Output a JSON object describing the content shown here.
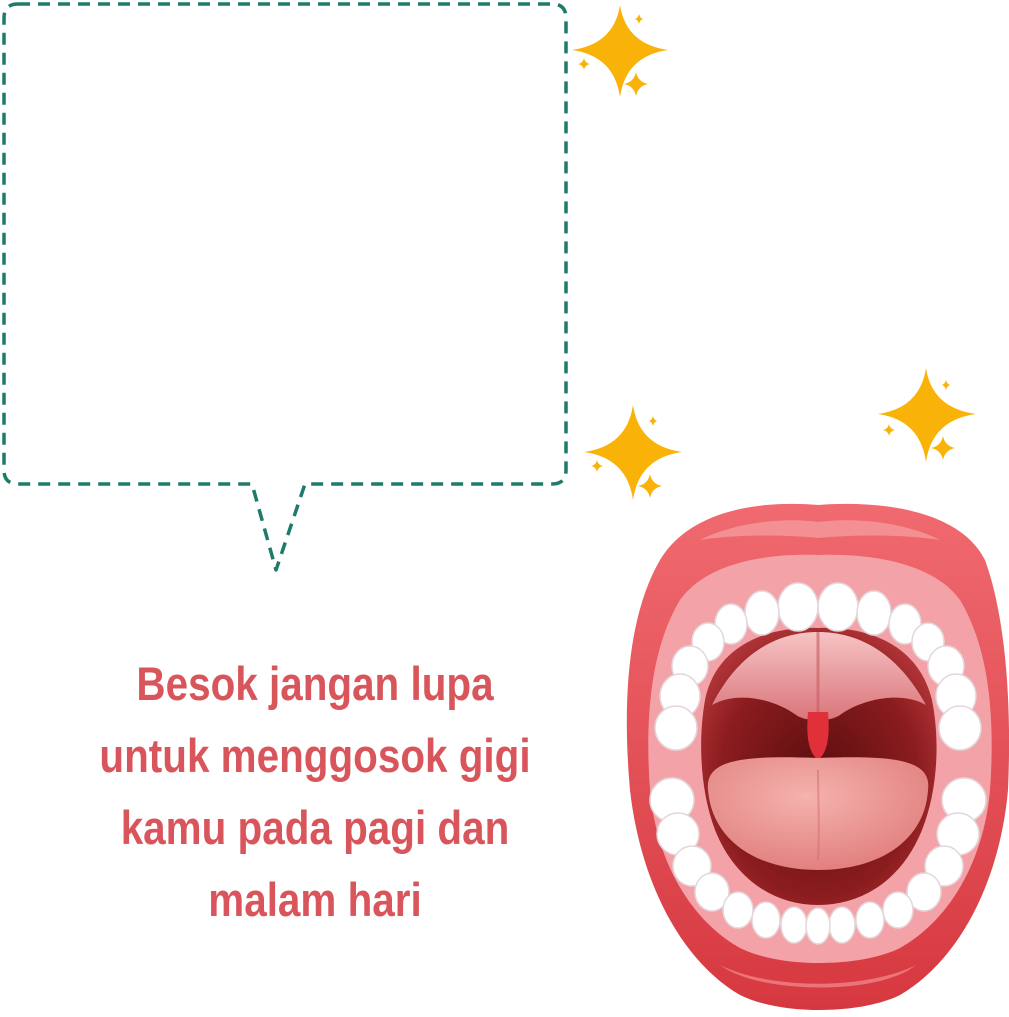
{
  "message": {
    "lines": [
      "Besok jangan lupa",
      "untuk menggosok gigi",
      "kamu pada pagi dan",
      "malam hari"
    ]
  },
  "colors": {
    "bubble_border": "#1e7a6a",
    "text": "#d9555c",
    "sparkle": "#f9b208",
    "lip": "#e2444b",
    "lip_highlight": "#f07a7e",
    "tongue": "#ec8f8e",
    "throat": "#7a1717",
    "teeth": "#ffffff",
    "uvula": "#e0303a"
  },
  "icons": [
    "speech-bubble-icon",
    "sparkle-icon",
    "open-mouth-illustration"
  ]
}
